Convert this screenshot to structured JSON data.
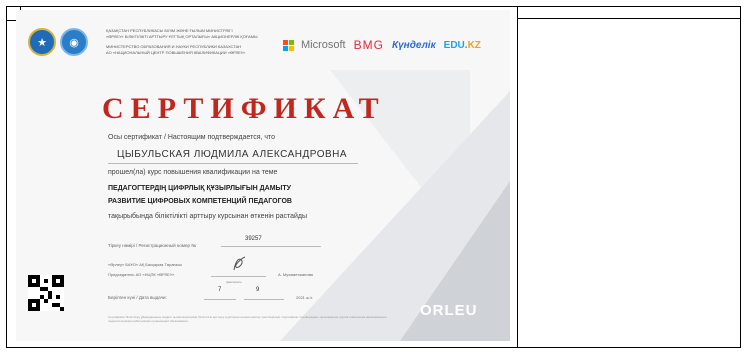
{
  "ministry": {
    "kk_line1": "ҚАЗАҚСТАН РЕСПУБЛИКАСЫ БІЛІМ ЖӘНЕ ҒЫЛЫМ МИНИСТРЛІГІ",
    "kk_line2": "«ӨРЛЕУ» БІЛІКТІЛІКТІ АРТТЫРУ ҰЛТТЫҚ ОРТАЛЫҒЫ» АКЦИОНЕРЛІК ҚОҒАМЫ",
    "ru_line1": "МИНИСТЕРСТВО ОБРАЗОВАНИЯ И НАУКИ РЕСПУБЛИКИ КАЗАХСТАН",
    "ru_line2": "АО «НАЦИОНАЛЬНЫЙ ЦЕНТР ПОВЫШЕНИЯ КВАЛИФИКАЦИИ «ӨРЛЕУ»"
  },
  "partners": {
    "microsoft": "Microsoft",
    "bmg": "BMG",
    "kundelik": "Күнделік",
    "edu_main": "EDU.",
    "edu_suffix": "KZ"
  },
  "certificate": {
    "title": "СЕРТИФИКАТ",
    "intro": "Осы сертификат / Настоящим подтверждается, что",
    "recipient": "ЦЫБУЛЬСКАЯ ЛЮДМИЛА АЛЕКСАНДРОВНА",
    "passed": "прошел(ла) курс повышения квалификации на теме",
    "course_kk": "ПЕДАГОГТЕРДІҢ ЦИФРЛЫҚ ҚҰЗЫРЛЫҒЫН ДАМЫТУ",
    "course_ru": "РАЗВИТИЕ ЦИФРОВЫХ КОМПЕТЕНЦИЙ ПЕДАГОГОВ",
    "confirm_kk": "тақырыбында біліктілікті арттыру курсынан өткенін растайды",
    "reg_label": "Тіркеу нөмірі / Регистрационный номер №",
    "reg_number": "39257",
    "sign_line1": "«Өрлеу» БАҰО» АҚ Басқарма Төрағасы",
    "sign_line2": "Председатель АО «НЦПК «ӨРЛЕУ»",
    "sign_name": "А. Мухаметжанова",
    "facsimile": "факсимиле",
    "date_label": "Берілген күні / Дата выдачи:",
    "day": "7",
    "month": "9",
    "year": "2021 ж./г.",
    "footer": "Сертификат білім беру ұйымдарының педагог қызметкерлерінің біліктілігін арттыру курстарын өткенін растау үшін беріледі. Сертификат подтверждает прохождение курсов повышения квалификации педагогическими работниками организаций образования.",
    "brand": "ORLEU"
  },
  "colors": {
    "title_red": "#c0281f",
    "bmg_red": "#e4283c",
    "kundelik_blue": "#2b6ccf",
    "edu_blue": "#1fa3e3",
    "edu_orange": "#f0a21d"
  }
}
